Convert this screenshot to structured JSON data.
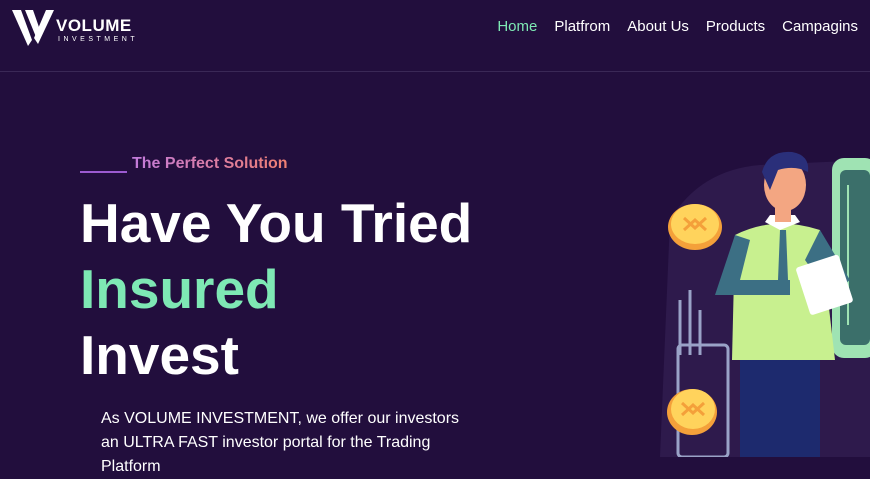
{
  "brand": {
    "title": "VOLUME",
    "subtitle": "INVESTMENT"
  },
  "nav": [
    {
      "label": "Home",
      "active": true
    },
    {
      "label": "Platfrom",
      "active": false
    },
    {
      "label": "About Us",
      "active": false
    },
    {
      "label": "Products",
      "active": false
    },
    {
      "label": "Campagins",
      "active": false
    }
  ],
  "hero": {
    "tagline": "The Perfect Solution",
    "line1": "Have You Tried",
    "line2": "Insured",
    "line3": "Invest",
    "description": "As VOLUME INVESTMENT, we offer our investors an ULTRA FAST investor portal for the Trading Platform"
  },
  "colors": {
    "background": "#220e3d",
    "accent": "#7ee8b4",
    "tagline_start": "#c27bdc",
    "tagline_end": "#f07f71"
  },
  "icons": {
    "logo": "v-logo-icon",
    "coins": "ripple-coin-icon"
  }
}
